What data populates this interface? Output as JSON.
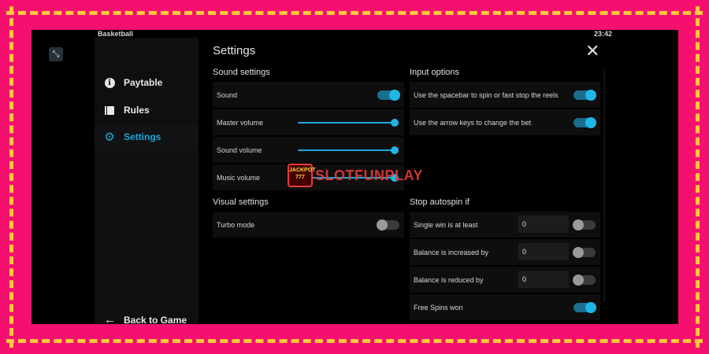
{
  "app": {
    "title": "Basketball",
    "time": "23:42"
  },
  "sidebar": {
    "items": [
      {
        "label": "Paytable",
        "icon": "info-icon"
      },
      {
        "label": "Rules",
        "icon": "book-icon"
      },
      {
        "label": "Settings",
        "icon": "gear-icon",
        "active": true
      }
    ],
    "back_label": "Back to Game"
  },
  "settings": {
    "title": "Settings",
    "sound": {
      "heading": "Sound settings",
      "sound_label": "Sound",
      "sound_on": true,
      "master_label": "Master volume",
      "master_level": 1.0,
      "sound_volume_label": "Sound volume",
      "sound_volume_level": 1.0,
      "music_label": "Music volume",
      "music_level": 1.0
    },
    "visual": {
      "heading": "Visual settings",
      "turbo_label": "Turbo mode",
      "turbo_on": false
    },
    "input": {
      "heading": "Input options",
      "spacebar_label": "Use the spacebar to spin or fast stop the reels",
      "spacebar_on": true,
      "arrow_label": "Use the arrow keys to change the bet",
      "arrow_on": true
    },
    "autospin": {
      "heading": "Stop autospin if",
      "single_win_label": "Single win is at least",
      "single_win_value": "0",
      "single_win_on": false,
      "balance_inc_label": "Balance is increased by",
      "balance_inc_value": "0",
      "balance_inc_on": false,
      "balance_dec_label": "Balance is reduced by",
      "balance_dec_value": "0",
      "balance_dec_on": false,
      "free_spins_label": "Free Spins won",
      "free_spins_on": true
    }
  },
  "watermark": {
    "logo_text": "JACKPOT 777",
    "text": "SLOTFUNPLAY"
  },
  "colors": {
    "accent": "#1aa9d8",
    "frame": "#f5106f",
    "frame_dash": "#ffc83a"
  }
}
